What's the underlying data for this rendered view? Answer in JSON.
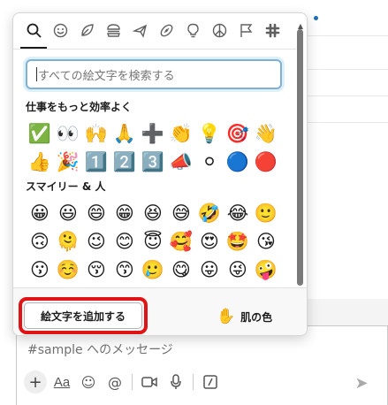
{
  "picker": {
    "category_tabs": [
      {
        "icon": "search-icon",
        "glyph": "🔍"
      },
      {
        "icon": "smiley-icon",
        "glyph": "☺"
      },
      {
        "icon": "leaf-icon",
        "glyph": "🍃"
      },
      {
        "icon": "burger-icon",
        "glyph": "🍔"
      },
      {
        "icon": "airplane-icon",
        "glyph": "✈"
      },
      {
        "icon": "football-icon",
        "glyph": "🏈"
      },
      {
        "icon": "lightbulb-icon",
        "glyph": "💡"
      },
      {
        "icon": "peace-icon",
        "glyph": "☮"
      },
      {
        "icon": "flag-icon",
        "glyph": "⚐"
      },
      {
        "icon": "slack-icon",
        "glyph": "✱"
      }
    ],
    "search_placeholder": "すべての絵文字を検索する",
    "sections": [
      {
        "title": "仕事をもっと効率よく",
        "emojis": [
          "✅",
          "👀",
          "🙌",
          "🙏",
          "➕",
          "👏",
          "💡",
          "🎯",
          "👋",
          "👍",
          "🎉",
          "1️⃣",
          "2️⃣",
          "3️⃣",
          "📣",
          "⚪",
          "🔵",
          "🔴"
        ]
      },
      {
        "title": "スマイリー & 人",
        "emojis": [
          "😀",
          "😃",
          "😄",
          "😁",
          "😆",
          "😅",
          "🤣",
          "😂",
          "🙂",
          "🙃",
          "🫠",
          "😉",
          "😊",
          "😇",
          "🥰",
          "😍",
          "🤩",
          "😘",
          "😗",
          "☺️",
          "😚",
          "😙",
          "🥲",
          "😋",
          "😛",
          "😜",
          "🤪",
          "😝",
          "🤑",
          "🤗",
          "🤭",
          "🫢",
          "🫣",
          "🤫",
          "🤔",
          "🫡"
        ]
      }
    ],
    "add_emoji_label": "絵文字を追加する",
    "skin_tone_label": "肌の色",
    "skin_tone_glyph": "✋"
  },
  "composer": {
    "placeholder": "#sample へのメッセージ",
    "toolbar": {
      "plus": "+",
      "format": "Aa",
      "emoji": "☺",
      "mention": "@",
      "video": "▭",
      "mic": "🎙",
      "slash": "/",
      "send": "➤"
    }
  },
  "colors": {
    "highlight": "#e01414",
    "search_focus": "#7fb0d8"
  }
}
